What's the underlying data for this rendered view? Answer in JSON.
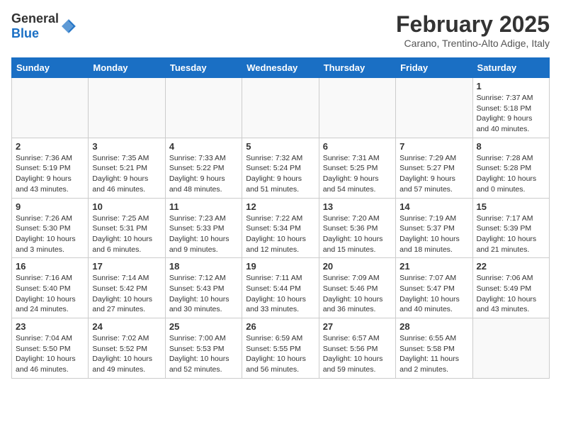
{
  "header": {
    "logo_general": "General",
    "logo_blue": "Blue",
    "title": "February 2025",
    "subtitle": "Carano, Trentino-Alto Adige, Italy"
  },
  "weekdays": [
    "Sunday",
    "Monday",
    "Tuesday",
    "Wednesday",
    "Thursday",
    "Friday",
    "Saturday"
  ],
  "weeks": [
    [
      {
        "day": "",
        "info": ""
      },
      {
        "day": "",
        "info": ""
      },
      {
        "day": "",
        "info": ""
      },
      {
        "day": "",
        "info": ""
      },
      {
        "day": "",
        "info": ""
      },
      {
        "day": "",
        "info": ""
      },
      {
        "day": "1",
        "info": "Sunrise: 7:37 AM\nSunset: 5:18 PM\nDaylight: 9 hours and 40 minutes."
      }
    ],
    [
      {
        "day": "2",
        "info": "Sunrise: 7:36 AM\nSunset: 5:19 PM\nDaylight: 9 hours and 43 minutes."
      },
      {
        "day": "3",
        "info": "Sunrise: 7:35 AM\nSunset: 5:21 PM\nDaylight: 9 hours and 46 minutes."
      },
      {
        "day": "4",
        "info": "Sunrise: 7:33 AM\nSunset: 5:22 PM\nDaylight: 9 hours and 48 minutes."
      },
      {
        "day": "5",
        "info": "Sunrise: 7:32 AM\nSunset: 5:24 PM\nDaylight: 9 hours and 51 minutes."
      },
      {
        "day": "6",
        "info": "Sunrise: 7:31 AM\nSunset: 5:25 PM\nDaylight: 9 hours and 54 minutes."
      },
      {
        "day": "7",
        "info": "Sunrise: 7:29 AM\nSunset: 5:27 PM\nDaylight: 9 hours and 57 minutes."
      },
      {
        "day": "8",
        "info": "Sunrise: 7:28 AM\nSunset: 5:28 PM\nDaylight: 10 hours and 0 minutes."
      }
    ],
    [
      {
        "day": "9",
        "info": "Sunrise: 7:26 AM\nSunset: 5:30 PM\nDaylight: 10 hours and 3 minutes."
      },
      {
        "day": "10",
        "info": "Sunrise: 7:25 AM\nSunset: 5:31 PM\nDaylight: 10 hours and 6 minutes."
      },
      {
        "day": "11",
        "info": "Sunrise: 7:23 AM\nSunset: 5:33 PM\nDaylight: 10 hours and 9 minutes."
      },
      {
        "day": "12",
        "info": "Sunrise: 7:22 AM\nSunset: 5:34 PM\nDaylight: 10 hours and 12 minutes."
      },
      {
        "day": "13",
        "info": "Sunrise: 7:20 AM\nSunset: 5:36 PM\nDaylight: 10 hours and 15 minutes."
      },
      {
        "day": "14",
        "info": "Sunrise: 7:19 AM\nSunset: 5:37 PM\nDaylight: 10 hours and 18 minutes."
      },
      {
        "day": "15",
        "info": "Sunrise: 7:17 AM\nSunset: 5:39 PM\nDaylight: 10 hours and 21 minutes."
      }
    ],
    [
      {
        "day": "16",
        "info": "Sunrise: 7:16 AM\nSunset: 5:40 PM\nDaylight: 10 hours and 24 minutes."
      },
      {
        "day": "17",
        "info": "Sunrise: 7:14 AM\nSunset: 5:42 PM\nDaylight: 10 hours and 27 minutes."
      },
      {
        "day": "18",
        "info": "Sunrise: 7:12 AM\nSunset: 5:43 PM\nDaylight: 10 hours and 30 minutes."
      },
      {
        "day": "19",
        "info": "Sunrise: 7:11 AM\nSunset: 5:44 PM\nDaylight: 10 hours and 33 minutes."
      },
      {
        "day": "20",
        "info": "Sunrise: 7:09 AM\nSunset: 5:46 PM\nDaylight: 10 hours and 36 minutes."
      },
      {
        "day": "21",
        "info": "Sunrise: 7:07 AM\nSunset: 5:47 PM\nDaylight: 10 hours and 40 minutes."
      },
      {
        "day": "22",
        "info": "Sunrise: 7:06 AM\nSunset: 5:49 PM\nDaylight: 10 hours and 43 minutes."
      }
    ],
    [
      {
        "day": "23",
        "info": "Sunrise: 7:04 AM\nSunset: 5:50 PM\nDaylight: 10 hours and 46 minutes."
      },
      {
        "day": "24",
        "info": "Sunrise: 7:02 AM\nSunset: 5:52 PM\nDaylight: 10 hours and 49 minutes."
      },
      {
        "day": "25",
        "info": "Sunrise: 7:00 AM\nSunset: 5:53 PM\nDaylight: 10 hours and 52 minutes."
      },
      {
        "day": "26",
        "info": "Sunrise: 6:59 AM\nSunset: 5:55 PM\nDaylight: 10 hours and 56 minutes."
      },
      {
        "day": "27",
        "info": "Sunrise: 6:57 AM\nSunset: 5:56 PM\nDaylight: 10 hours and 59 minutes."
      },
      {
        "day": "28",
        "info": "Sunrise: 6:55 AM\nSunset: 5:58 PM\nDaylight: 11 hours and 2 minutes."
      },
      {
        "day": "",
        "info": ""
      }
    ]
  ]
}
